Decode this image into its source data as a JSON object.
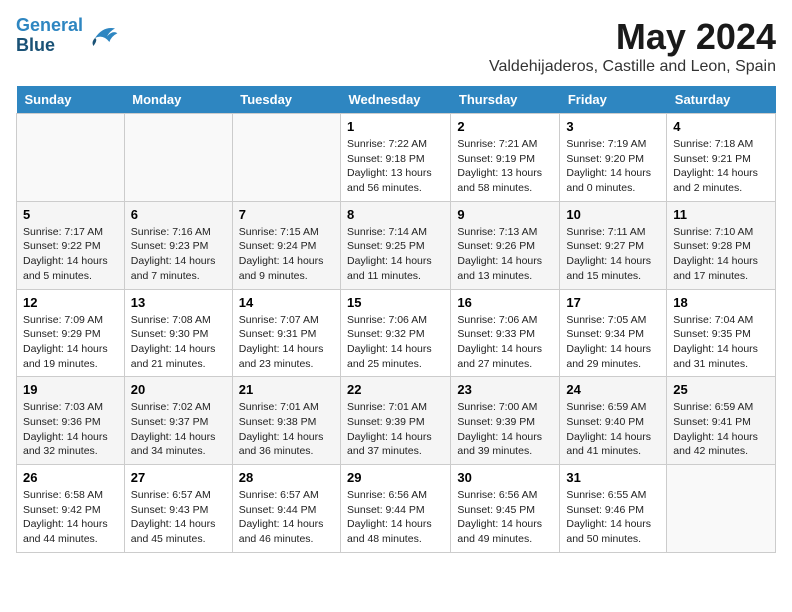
{
  "header": {
    "logo_line1": "General",
    "logo_line2": "Blue",
    "month": "May 2024",
    "location": "Valdehijaderos, Castille and Leon, Spain"
  },
  "weekdays": [
    "Sunday",
    "Monday",
    "Tuesday",
    "Wednesday",
    "Thursday",
    "Friday",
    "Saturday"
  ],
  "weeks": [
    [
      {
        "day": "",
        "info": ""
      },
      {
        "day": "",
        "info": ""
      },
      {
        "day": "",
        "info": ""
      },
      {
        "day": "1",
        "info": "Sunrise: 7:22 AM\nSunset: 9:18 PM\nDaylight: 13 hours\nand 56 minutes."
      },
      {
        "day": "2",
        "info": "Sunrise: 7:21 AM\nSunset: 9:19 PM\nDaylight: 13 hours\nand 58 minutes."
      },
      {
        "day": "3",
        "info": "Sunrise: 7:19 AM\nSunset: 9:20 PM\nDaylight: 14 hours\nand 0 minutes."
      },
      {
        "day": "4",
        "info": "Sunrise: 7:18 AM\nSunset: 9:21 PM\nDaylight: 14 hours\nand 2 minutes."
      }
    ],
    [
      {
        "day": "5",
        "info": "Sunrise: 7:17 AM\nSunset: 9:22 PM\nDaylight: 14 hours\nand 5 minutes."
      },
      {
        "day": "6",
        "info": "Sunrise: 7:16 AM\nSunset: 9:23 PM\nDaylight: 14 hours\nand 7 minutes."
      },
      {
        "day": "7",
        "info": "Sunrise: 7:15 AM\nSunset: 9:24 PM\nDaylight: 14 hours\nand 9 minutes."
      },
      {
        "day": "8",
        "info": "Sunrise: 7:14 AM\nSunset: 9:25 PM\nDaylight: 14 hours\nand 11 minutes."
      },
      {
        "day": "9",
        "info": "Sunrise: 7:13 AM\nSunset: 9:26 PM\nDaylight: 14 hours\nand 13 minutes."
      },
      {
        "day": "10",
        "info": "Sunrise: 7:11 AM\nSunset: 9:27 PM\nDaylight: 14 hours\nand 15 minutes."
      },
      {
        "day": "11",
        "info": "Sunrise: 7:10 AM\nSunset: 9:28 PM\nDaylight: 14 hours\nand 17 minutes."
      }
    ],
    [
      {
        "day": "12",
        "info": "Sunrise: 7:09 AM\nSunset: 9:29 PM\nDaylight: 14 hours\nand 19 minutes."
      },
      {
        "day": "13",
        "info": "Sunrise: 7:08 AM\nSunset: 9:30 PM\nDaylight: 14 hours\nand 21 minutes."
      },
      {
        "day": "14",
        "info": "Sunrise: 7:07 AM\nSunset: 9:31 PM\nDaylight: 14 hours\nand 23 minutes."
      },
      {
        "day": "15",
        "info": "Sunrise: 7:06 AM\nSunset: 9:32 PM\nDaylight: 14 hours\nand 25 minutes."
      },
      {
        "day": "16",
        "info": "Sunrise: 7:06 AM\nSunset: 9:33 PM\nDaylight: 14 hours\nand 27 minutes."
      },
      {
        "day": "17",
        "info": "Sunrise: 7:05 AM\nSunset: 9:34 PM\nDaylight: 14 hours\nand 29 minutes."
      },
      {
        "day": "18",
        "info": "Sunrise: 7:04 AM\nSunset: 9:35 PM\nDaylight: 14 hours\nand 31 minutes."
      }
    ],
    [
      {
        "day": "19",
        "info": "Sunrise: 7:03 AM\nSunset: 9:36 PM\nDaylight: 14 hours\nand 32 minutes."
      },
      {
        "day": "20",
        "info": "Sunrise: 7:02 AM\nSunset: 9:37 PM\nDaylight: 14 hours\nand 34 minutes."
      },
      {
        "day": "21",
        "info": "Sunrise: 7:01 AM\nSunset: 9:38 PM\nDaylight: 14 hours\nand 36 minutes."
      },
      {
        "day": "22",
        "info": "Sunrise: 7:01 AM\nSunset: 9:39 PM\nDaylight: 14 hours\nand 37 minutes."
      },
      {
        "day": "23",
        "info": "Sunrise: 7:00 AM\nSunset: 9:39 PM\nDaylight: 14 hours\nand 39 minutes."
      },
      {
        "day": "24",
        "info": "Sunrise: 6:59 AM\nSunset: 9:40 PM\nDaylight: 14 hours\nand 41 minutes."
      },
      {
        "day": "25",
        "info": "Sunrise: 6:59 AM\nSunset: 9:41 PM\nDaylight: 14 hours\nand 42 minutes."
      }
    ],
    [
      {
        "day": "26",
        "info": "Sunrise: 6:58 AM\nSunset: 9:42 PM\nDaylight: 14 hours\nand 44 minutes."
      },
      {
        "day": "27",
        "info": "Sunrise: 6:57 AM\nSunset: 9:43 PM\nDaylight: 14 hours\nand 45 minutes."
      },
      {
        "day": "28",
        "info": "Sunrise: 6:57 AM\nSunset: 9:44 PM\nDaylight: 14 hours\nand 46 minutes."
      },
      {
        "day": "29",
        "info": "Sunrise: 6:56 AM\nSunset: 9:44 PM\nDaylight: 14 hours\nand 48 minutes."
      },
      {
        "day": "30",
        "info": "Sunrise: 6:56 AM\nSunset: 9:45 PM\nDaylight: 14 hours\nand 49 minutes."
      },
      {
        "day": "31",
        "info": "Sunrise: 6:55 AM\nSunset: 9:46 PM\nDaylight: 14 hours\nand 50 minutes."
      },
      {
        "day": "",
        "info": ""
      }
    ]
  ]
}
